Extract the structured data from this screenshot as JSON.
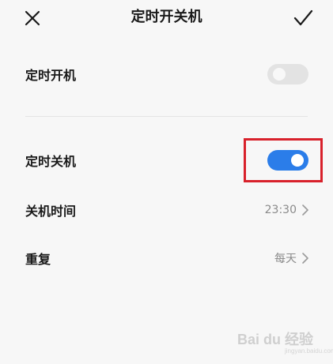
{
  "header": {
    "title": "定时开关机",
    "close_icon": "close-icon",
    "confirm_icon": "check-icon"
  },
  "settings": {
    "power_on": {
      "label": "定时开机",
      "enabled": false
    },
    "power_off": {
      "label": "定时关机",
      "enabled": true
    },
    "shutdown_time": {
      "label": "关机时间",
      "value": "23:30"
    },
    "repeat": {
      "label": "重复",
      "value": "每天"
    }
  },
  "colors": {
    "toggle_on": "#2b7de9",
    "toggle_off": "#e3e3e3",
    "highlight": "#d8212b",
    "background": "#f7f7f7"
  },
  "watermark": {
    "brand": "Bai du 经验",
    "site": "jingyan.baidu.com"
  }
}
